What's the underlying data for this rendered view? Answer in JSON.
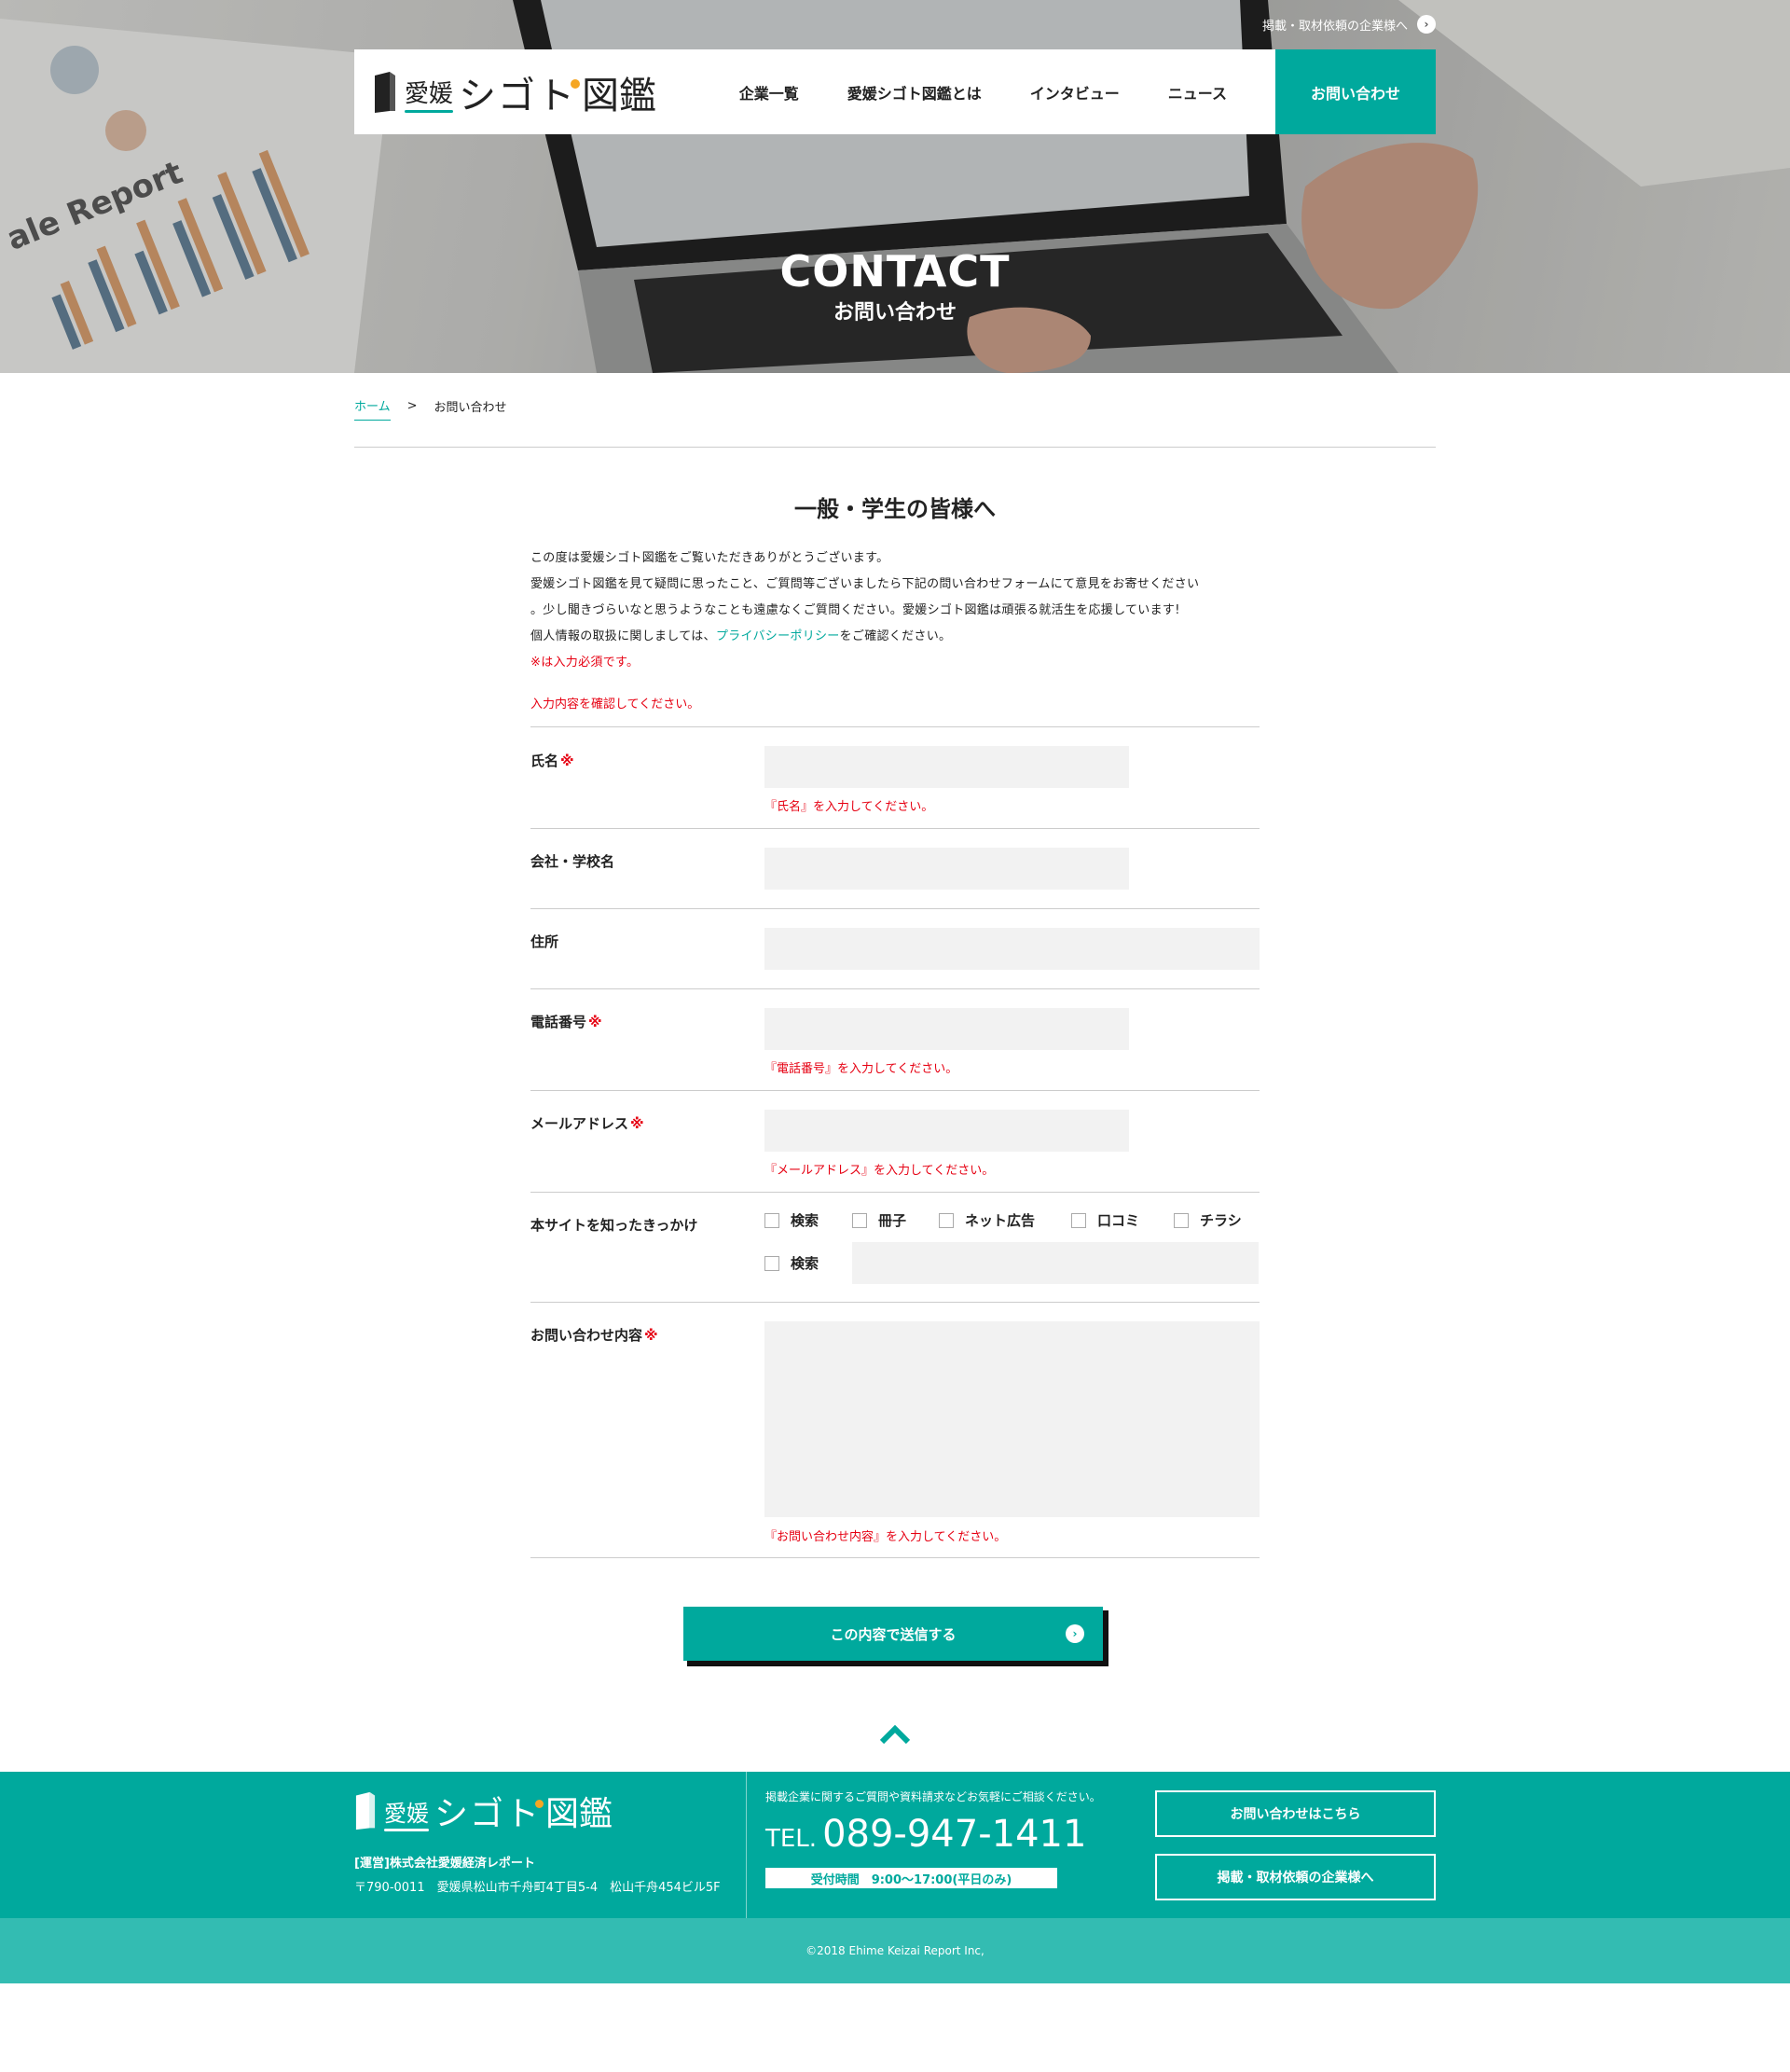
{
  "header": {
    "topbar_link": "掲載・取材依頼の企業様へ",
    "logo": {
      "pre": "愛媛",
      "main": "シゴト",
      "tail": "図鑑"
    },
    "nav": [
      "企業一覧",
      "愛媛シゴト図鑑とは",
      "インタビュー",
      "ニュース"
    ],
    "nav_contact": "お問い合わせ"
  },
  "hero": {
    "title": "CONTACT",
    "subtitle": "お問い合わせ",
    "background_text": "ale Report"
  },
  "breadcrumb": {
    "home": "ホーム",
    "separator": ">",
    "current": "お問い合わせ"
  },
  "section_title": "一般・学生の皆様へ",
  "intro": {
    "line1": "この度は愛媛シゴト図鑑をご覧いただきありがとうございます。",
    "line2": "愛媛シゴト図鑑を見て疑問に思ったこと、ご質問等ございましたら下記の問い合わせフォームにて意見をお寄せください",
    "line3": "。少し聞きづらいなと思うようなことも遠慮なくご質問ください。愛媛シゴト図鑑は頑張る就活生を応援しています!",
    "line4_pre": "個人情報の取扱に関しましては、",
    "line4_link": "プライバシーポリシー",
    "line4_post": "をご確認ください。",
    "required_note": "※は入力必須です。"
  },
  "confirm_message": "入力内容を確認してください。",
  "form": {
    "required_mark": "※",
    "name": {
      "label": "氏名",
      "error": "『氏名』を入力してください。"
    },
    "company": {
      "label": "会社・学校名"
    },
    "address": {
      "label": "住所"
    },
    "phone": {
      "label": "電話番号",
      "error": "『電話番号』を入力してください。"
    },
    "email": {
      "label": "メールアドレス",
      "error": "『メールアドレス』を入力してください。"
    },
    "source": {
      "label": "本サイトを知ったきっかけ",
      "options": [
        "検索",
        "冊子",
        "ネット広告",
        "口コミ",
        "チラシ",
        "検索"
      ]
    },
    "inquiry": {
      "label": "お問い合わせ内容",
      "error": "『お問い合わせ内容』を入力してください。"
    },
    "submit": "この内容で送信する"
  },
  "footer": {
    "logo": {
      "pre": "愛媛",
      "main": "シゴト",
      "tail": "図鑑"
    },
    "operator": "[運営]株式会社愛媛経済レポート",
    "address": "〒790-0011　愛媛県松山市千舟町4丁目5-4　松山千舟454ビル5F",
    "lead": "掲載企業に関するご質問や資料請求などお気軽にご相談ください。",
    "tel_prefix": "TEL.",
    "tel_number": "089-947-1411",
    "hours": "受付時間　9:00〜17:00(平日のみ)",
    "btn_contact": "お問い合わせはこちら",
    "btn_company": "掲載・取材依頼の企業様へ",
    "copyright": "©2018 Ehime Keizai Report Inc,"
  },
  "colors": {
    "accent": "#00a99d",
    "accent_light": "#33bcb2",
    "error": "#e60012",
    "field_bg": "#f2f2f2"
  },
  "icons": [
    "arrow-circle-icon",
    "checkbox-icon",
    "chevron-up-icon",
    "book-logo-icon"
  ]
}
